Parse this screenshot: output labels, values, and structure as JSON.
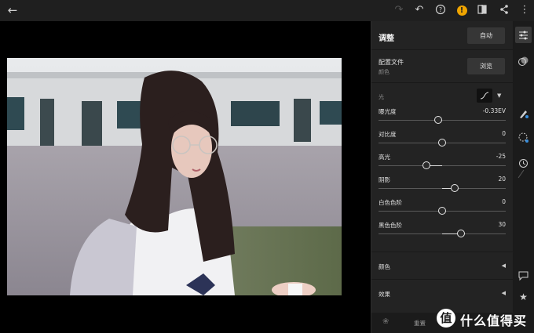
{
  "topbar": {
    "icons": [
      "back-arrow-icon",
      "redo-icon",
      "undo-icon",
      "help-icon",
      "warning-icon",
      "compare-icon",
      "share-icon",
      "more-icon"
    ]
  },
  "panel": {
    "title": "调整",
    "auto_label": "自动",
    "profile_label": "配置文件",
    "profile_value": "颜色",
    "browse_label": "浏览",
    "light_label": "光",
    "sliders": [
      {
        "label": "曝光度",
        "value": "-0.33EV",
        "level": -0.066
      },
      {
        "label": "对比度",
        "value": "0",
        "level": 0
      },
      {
        "label": "高光",
        "value": "-25",
        "level": -0.25
      },
      {
        "label": "阴影",
        "value": "20",
        "level": 0.2
      },
      {
        "label": "白色色阶",
        "value": "0",
        "level": 0
      },
      {
        "label": "黑色色阶",
        "value": "30",
        "level": 0.3
      }
    ],
    "sections": [
      {
        "label": "颜色"
      },
      {
        "label": "效果"
      }
    ],
    "reset_label": "重置"
  },
  "rail": {
    "icons": [
      "adjust-sliders-icon",
      "color-mix-icon",
      "healing-brush-icon",
      "selective-adjust-icon",
      "history-icon",
      "comment-icon",
      "star-icon"
    ]
  },
  "watermark": {
    "badge": "值",
    "text": "什么值得买"
  }
}
